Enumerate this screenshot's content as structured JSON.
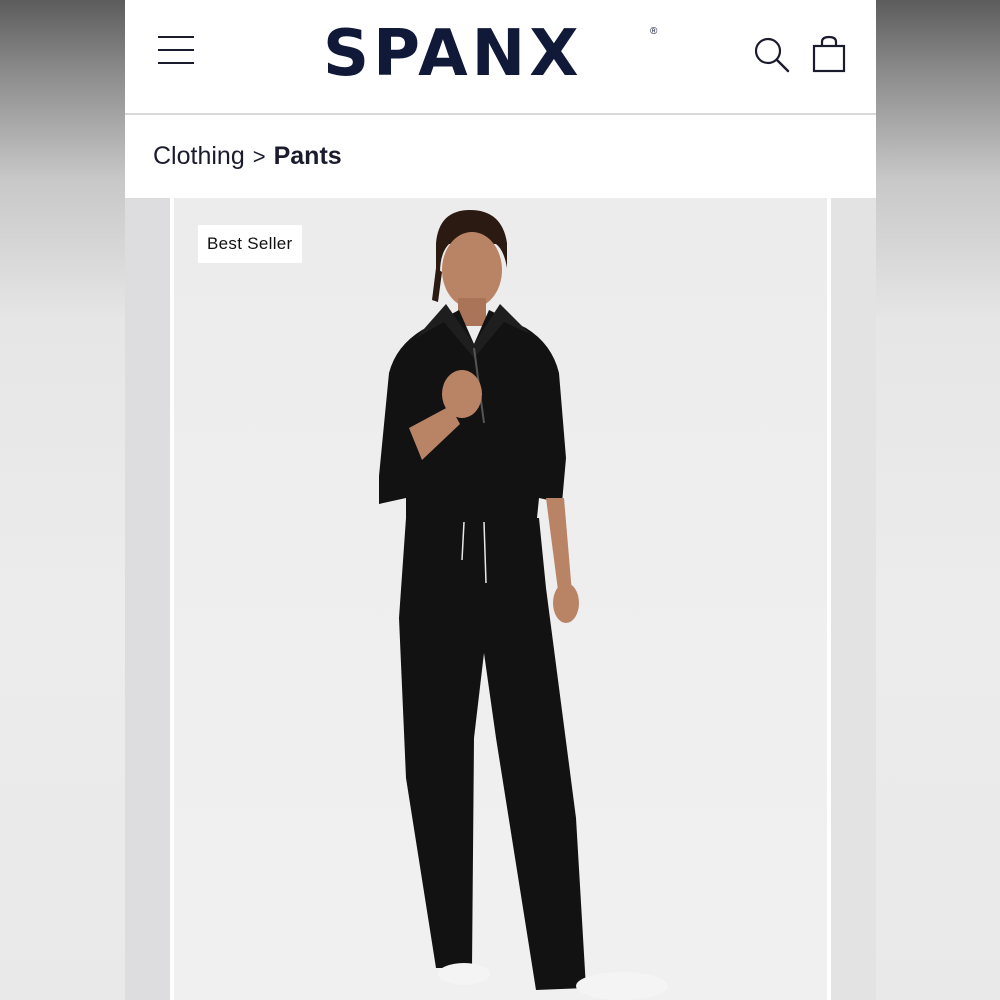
{
  "header": {
    "logo": "SPANX",
    "logo_mark": "®"
  },
  "breadcrumb": {
    "parent": "Clothing",
    "separator": ">",
    "current": "Pants"
  },
  "product": {
    "badge": "Best Seller",
    "colors": {
      "garment": "#121212",
      "skin": "#b98466",
      "hair": "#2a1a12"
    }
  }
}
